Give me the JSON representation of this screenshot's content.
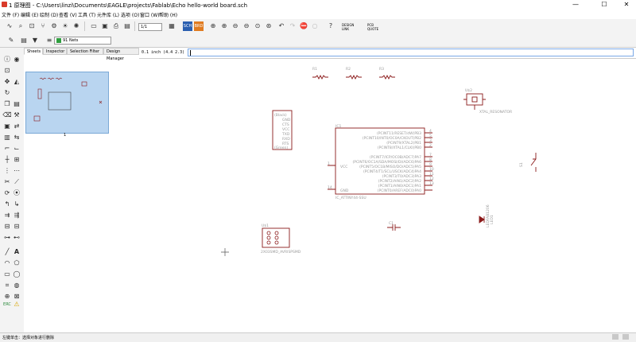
{
  "window": {
    "title": "1 原理图 - C:\\Users\\linzi\\Documents\\EAGLE\\projects\\Fablab\\Echo hello-world board.sch",
    "minimize": "—",
    "maximize": "☐",
    "close": "✕"
  },
  "menu": [
    "文件 (F)",
    "编辑 (E)",
    "绘制 (D)",
    "查看 (V)",
    "工具 (T)",
    "元件库 (L)",
    "选项 (O)",
    "窗口 (W)",
    "帮助 (H)"
  ],
  "toolbar": {
    "sheet_select": "1/1",
    "design_link": "DESIGN LINK",
    "web_quote": "PCB QUOTE",
    "layer_select": "91 Nets",
    "grid_readout": "0.1 inch (4.4 2.3)"
  },
  "left_panel": {
    "tabs": [
      "Sheets",
      "Inspector",
      "Selection Filter",
      "Design Manager"
    ],
    "sheet_number": "1"
  },
  "status_bar": {
    "message": "左键单击：选择对象进行删除"
  },
  "schematic": {
    "resistors": [
      "R1",
      "R2",
      "R3"
    ],
    "ftdi_pins": [
      "(Black)",
      "GND",
      "CTS",
      "VCC",
      "TXD",
      "RXD",
      "RTS",
      "(Green)"
    ],
    "ic": {
      "ref": "IC1",
      "name": "IC_ATTINY44-SSU",
      "left_pins": [
        {
          "num": "1",
          "name": "VCC"
        },
        {
          "num": "14",
          "name": "GND"
        }
      ],
      "right_pins": [
        {
          "num": "4",
          "name": "(PCINT11/RESET/dW)PB3"
        },
        {
          "num": "5",
          "name": "(PCINT10/INT0/OC0A/CKOUT)PB2"
        },
        {
          "num": "3",
          "name": "(PCINT9/XTAL2)PB1"
        },
        {
          "num": "2",
          "name": "(PCINT8/XTAL1/CLKI)PB0"
        },
        {
          "num": "7",
          "name": "(PCINT7/ICP/OC0B/ADC7)PA7"
        },
        {
          "num": "8",
          "name": "(PCINT6/OC1A/SDA/MOSI/DI/ADC6)PA6"
        },
        {
          "num": "9",
          "name": "(PCINT5/OC1B/MISO/DO/ADC5)PA5"
        },
        {
          "num": "10",
          "name": "(PCINT4/T1/SCL/USCK/ADC4)PA4"
        },
        {
          "num": "11",
          "name": "(PCINT3/T0/ADC3)PA3"
        },
        {
          "num": "12",
          "name": "(PCINT2/AIN1/ADC2)PA2"
        },
        {
          "num": "13",
          "name": "(PCINT1/AIN0/ADC1)PA1"
        },
        {
          "num": "",
          "name": "(PCINT0/AREF/ADC0)PA0"
        }
      ]
    },
    "resonator": {
      "ref": "U$2",
      "name": "XTAL_RESONATOR"
    },
    "switch": {
      "ref": "S1"
    },
    "led": {
      "ref": "LED1",
      "name": "LEDFAB1206"
    },
    "capacitor": {
      "ref": "C1"
    },
    "isp": {
      "ref": "U$1",
      "name": "2X03SMD_AVRISPSMD"
    }
  }
}
